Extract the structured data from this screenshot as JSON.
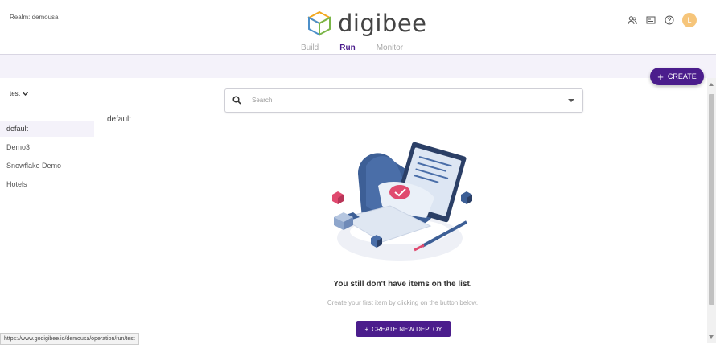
{
  "header": {
    "realm_label": "Realm: demousa",
    "logo_text": "digibee",
    "nav": [
      {
        "label": "Build"
      },
      {
        "label": "Run"
      },
      {
        "label": "Monitor"
      }
    ],
    "avatar_initial": "L"
  },
  "toolbar": {
    "create_label": "CREATE"
  },
  "environment": {
    "selected": "test"
  },
  "sidebar": {
    "items": [
      {
        "label": "default"
      },
      {
        "label": "Demo3"
      },
      {
        "label": "Snowflake Demo"
      },
      {
        "label": "Hotels"
      }
    ]
  },
  "main": {
    "section_title": "default",
    "search_placeholder": "Search",
    "empty_title": "You still don't have items on the list.",
    "empty_subtitle": "Create your first item by clicking on the button below.",
    "deploy_button": "CREATE NEW DEPLOY"
  },
  "status_bar": {
    "url": "https://www.godigibee.io/demousa/operation/run/test"
  },
  "colors": {
    "accent": "#4b1d8c",
    "avatar": "#f6c57a",
    "band": "#f4f2fa"
  }
}
